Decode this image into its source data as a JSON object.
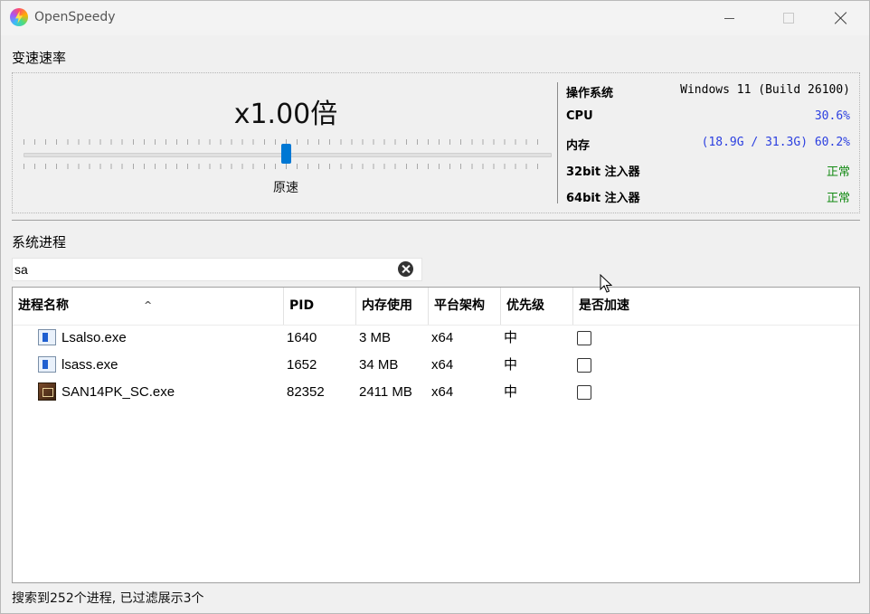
{
  "window": {
    "title": "OpenSpeedy"
  },
  "speed": {
    "section_label": "变速速率",
    "value": "x1.00倍",
    "slider_label": "原速",
    "slider_position": 0.5
  },
  "system_info": {
    "rows": [
      {
        "key": "操作系统",
        "value": "Windows 11 (Build 26100)",
        "color": "#000000"
      },
      {
        "key": "CPU",
        "value": "30.6%",
        "color": "#2b3fe0"
      },
      {
        "key": "内存",
        "value": "(18.9G / 31.3G) 60.2%",
        "color": "#2b3fe0"
      },
      {
        "key": "32bit 注入器",
        "value": "正常",
        "color": "#138a13"
      },
      {
        "key": "64bit 注入器",
        "value": "正常",
        "color": "#138a13"
      }
    ]
  },
  "process_section": {
    "label": "系统进程",
    "search": {
      "value": "sa",
      "placeholder": ""
    },
    "columns": [
      "进程名称",
      "PID",
      "内存使用",
      "平台架构",
      "优先级",
      "是否加速"
    ],
    "rows": [
      {
        "icon": "system-process-icon",
        "name": "Lsalso.exe",
        "pid": "1640",
        "memory": "3 MB",
        "arch": "x64",
        "priority": "中",
        "accelerated": false
      },
      {
        "icon": "system-process-icon",
        "name": "lsass.exe",
        "pid": "1652",
        "memory": "34 MB",
        "arch": "x64",
        "priority": "中",
        "accelerated": false
      },
      {
        "icon": "game-app-icon",
        "name": "SAN14PK_SC.exe",
        "pid": "82352",
        "memory": "2411 MB",
        "arch": "x64",
        "priority": "中",
        "accelerated": false
      }
    ]
  },
  "status": {
    "text": "搜索到252个进程, 已过滤展示3个"
  }
}
